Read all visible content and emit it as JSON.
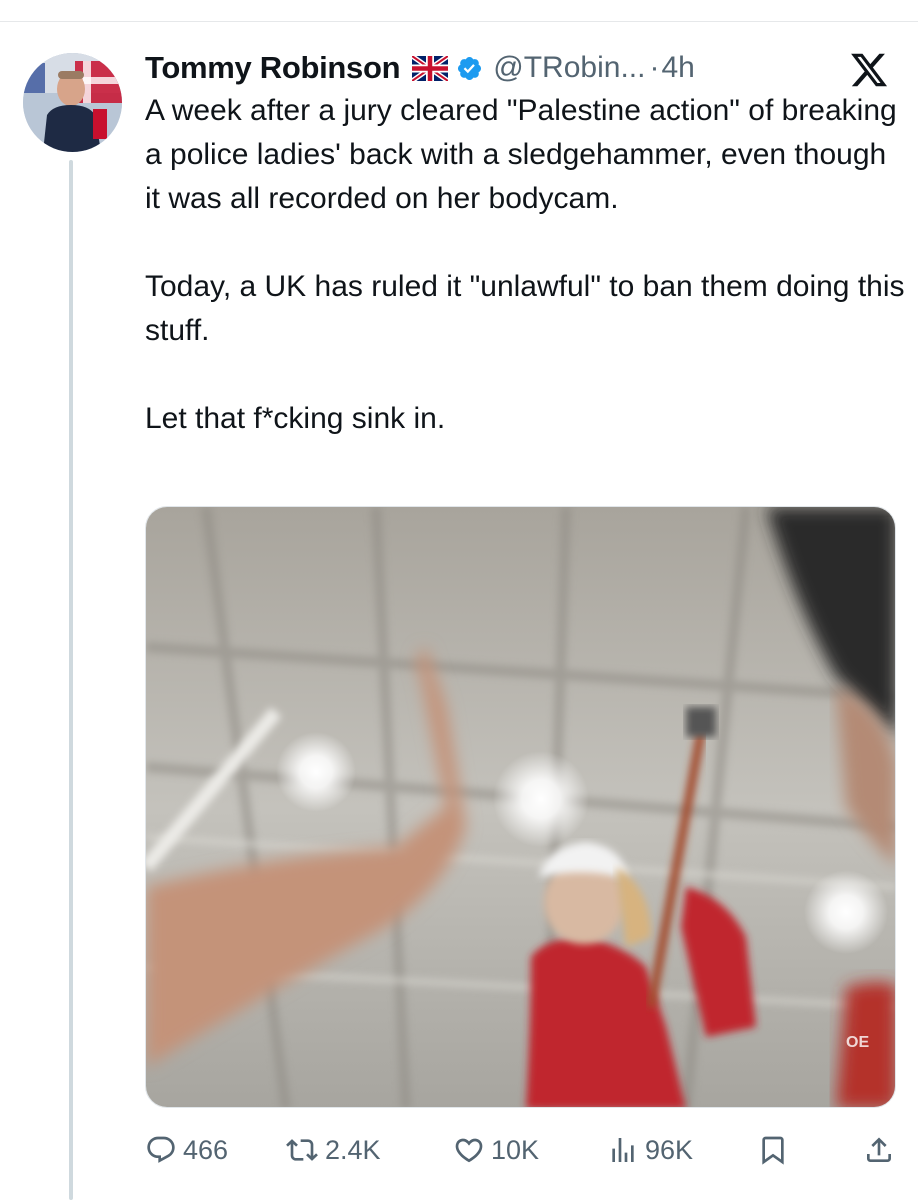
{
  "tweet": {
    "author": {
      "display_name": "Tommy Robinson",
      "handle": "@TRobin...",
      "flag_icon": "uk-flag-icon",
      "verified_icon": "verified-badge-icon",
      "verified_color": "#1d9bf0"
    },
    "separator": "·",
    "timestamp": "4h",
    "platform_logo": "x-logo-icon",
    "paragraphs": [
      "A week after a jury cleared \"Palestine action\" of breaking a police ladies' back with a sledgehammer, even though it was all recorded on her bodycam.",
      "Today, a UK has ruled it \"unlawful\" to ban them doing this stuff.",
      "Let that f*cking sink in."
    ],
    "media": {
      "type": "image",
      "watermark": "OE"
    },
    "actions": {
      "replies": "466",
      "reposts": "2.4K",
      "likes": "10K",
      "views": "96K"
    }
  },
  "colors": {
    "text": "#0f1419",
    "secondary_text": "#536471",
    "divider": "#e6e8ea",
    "thread_line": "#cfd9de"
  },
  "icons": [
    "reply-icon",
    "repost-icon",
    "like-icon",
    "views-icon",
    "bookmark-icon",
    "share-icon"
  ]
}
